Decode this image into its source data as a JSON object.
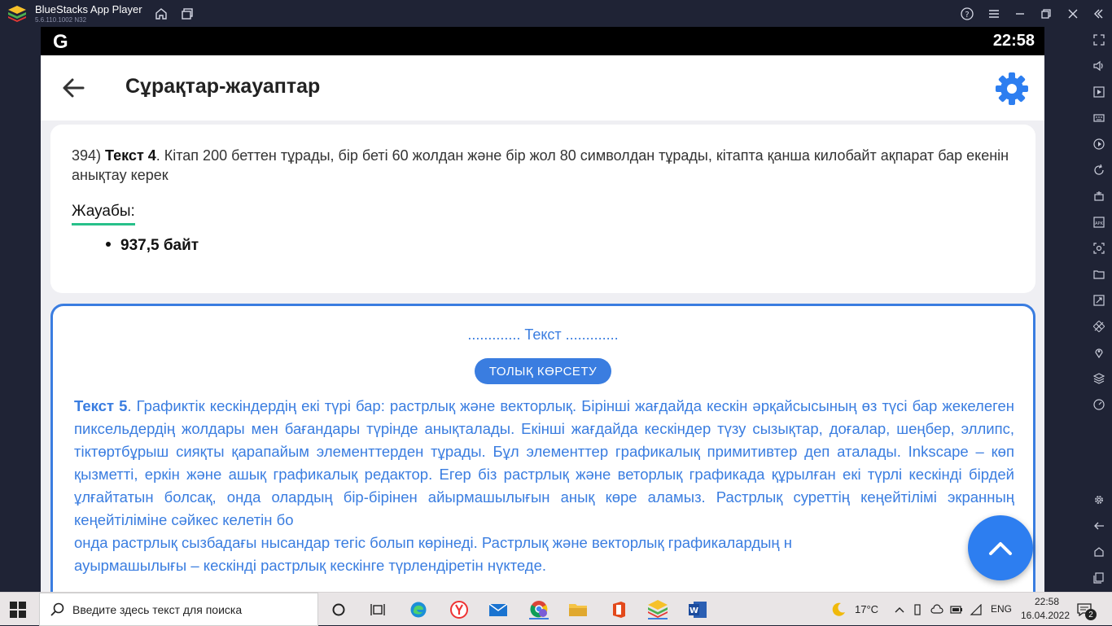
{
  "window": {
    "app_name": "BlueStacks App Player",
    "version": "5.6.110.1002 N32"
  },
  "status_bar": {
    "logo_letter": "G",
    "time": "22:58"
  },
  "app_bar": {
    "title": "Сұрақтар-жауаптар",
    "back_icon": "arrow-left-icon",
    "settings_icon": "gear-icon"
  },
  "question_card": {
    "number": "394)",
    "label": "Текст 4",
    "text": ". Кітап 200 беттен тұрады, бір беті 60 жолдан және бір жол 80 символдан тұрады, кітапта қанша килобайт ақпарат бар екенін анықтау керек",
    "answer_label": "Жауабы:",
    "answers": [
      "937,5 байт"
    ]
  },
  "text_card": {
    "section_label": "............. Текст .............",
    "show_full_button": "ТОЛЫҚ КӨРСЕТУ",
    "text_label": "Текст 5",
    "text_body": ". Графиктік кескіндердің екі түрі бар: растрлық және векторлық. Бірінші жағдайда кескін әрқайсысының өз түсі бар жекелеген пиксельдердің жолдары мен бағандары түрінде анықталады. Екінші жағдайда кескіндер түзу сызықтар, доғалар, шеңбер, эллипс, тіктөртбұрыш сияқты қарапайым элементтерден тұрады. Бұл элементтер графикалық примитивтер деп аталады. Inkscape – көп қызметті, еркін және ашық графикалық редактор. Егер біз растрлық және веторлық графикада құрылған екі түрлі кескінді бірдей ұлғайтатын болсақ, онда олардың бір-бірінен айырмашылығын анық көре аламыз. Растрлық суреттің кеңейтілімі экранның кеңейтіліміне сәйкес келетін бо",
    "text_body_2": "онда растрлық сызбадағы нысандар тегіс болып көрінеді. Растрлық және векторлық графикалардың н",
    "text_body_3": "ауырмашылығы – кескінді растрлық кескінге түрлендіретін нүктеде."
  },
  "taskbar": {
    "search_placeholder": "Введите здесь текст для поиска",
    "weather_temp": "17°C",
    "language": "ENG",
    "time": "22:58",
    "date": "16.04.2022",
    "notification_count": "2"
  },
  "colors": {
    "accent": "#3a7de0",
    "answer_underline": "#28c08a",
    "fab": "#2d7ef0",
    "title_bar": "#1f2335"
  }
}
